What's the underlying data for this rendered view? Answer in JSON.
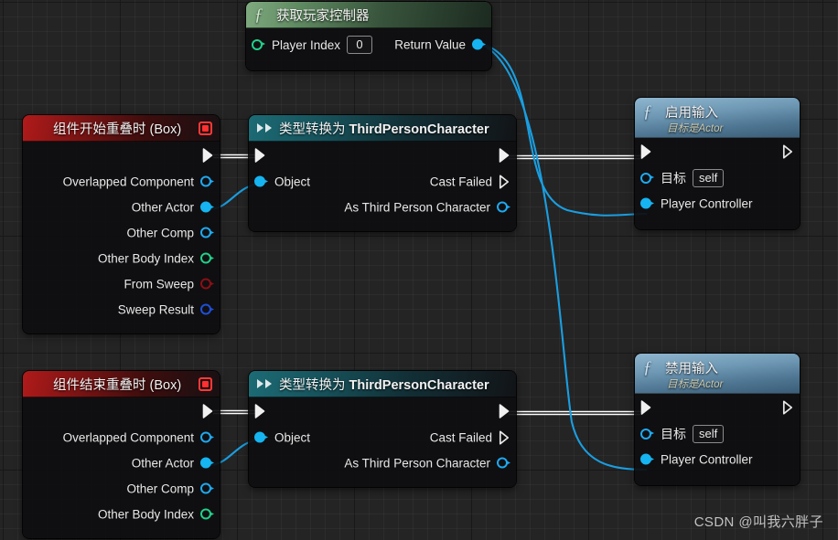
{
  "canvas": {
    "background_color": "#242424",
    "grid_minor_color": "#2f2f2f",
    "grid_major_color": "#151515"
  },
  "watermark": {
    "text": "CSDN @叫我六胖子"
  },
  "pin_colors": {
    "exec": "#ffffff",
    "object": "#1fa9f0",
    "actor": "#16b4f0",
    "int": "#22d08a",
    "bool": "#8b0f14",
    "struct": "#1f4fd8"
  },
  "nodes": [
    {
      "id": "get-player-controller",
      "title": "获取玩家控制器",
      "subtitle": "",
      "header_color": "#5f8a61",
      "icon": "function-fx-icon",
      "inputs": [
        {
          "label": "Player Index",
          "pin": "int",
          "value": "0"
        }
      ],
      "outputs": [
        {
          "label": "Return Value",
          "pin": "actor"
        }
      ]
    },
    {
      "id": "on-component-begin-overlap",
      "title": "组件开始重叠时 (Box)",
      "header_color": "#b01a1a",
      "icon": "event-diamond-icon",
      "has_stop_badge": true,
      "exec_out": true,
      "outputs": [
        {
          "label": "Overlapped Component",
          "pin": "object"
        },
        {
          "label": "Other Actor",
          "pin": "actor"
        },
        {
          "label": "Other Comp",
          "pin": "object"
        },
        {
          "label": "Other Body Index",
          "pin": "int"
        },
        {
          "label": "From Sweep",
          "pin": "bool"
        },
        {
          "label": "Sweep Result",
          "pin": "struct"
        }
      ]
    },
    {
      "id": "cast-to-thirdpersoncharacter-1",
      "title_prefix": "类型转换为 ",
      "title_class": "ThirdPersonCharacter",
      "header_color": "#17545d",
      "icon": "cast-arrows-icon",
      "exec_in": true,
      "exec_out": true,
      "inputs": [
        {
          "label": "Object",
          "pin": "object"
        }
      ],
      "outputs": [
        {
          "label": "Cast Failed",
          "pin": "exec"
        },
        {
          "label": "As Third Person Character",
          "pin": "object"
        }
      ]
    },
    {
      "id": "enable-input",
      "title": "启用输入",
      "subtitle": "目标是Actor",
      "header_color": "#6e98b4",
      "icon": "function-fx-icon",
      "exec_in": true,
      "exec_out": true,
      "inputs": [
        {
          "label": "目标",
          "pin": "object",
          "value": "self"
        },
        {
          "label": "Player Controller",
          "pin": "actor"
        }
      ]
    },
    {
      "id": "on-component-end-overlap",
      "title": "组件结束重叠时 (Box)",
      "header_color": "#b01a1a",
      "icon": "event-diamond-icon",
      "has_stop_badge": true,
      "exec_out": true,
      "outputs": [
        {
          "label": "Overlapped Component",
          "pin": "object"
        },
        {
          "label": "Other Actor",
          "pin": "actor"
        },
        {
          "label": "Other Comp",
          "pin": "object"
        },
        {
          "label": "Other Body Index",
          "pin": "int"
        }
      ]
    },
    {
      "id": "cast-to-thirdpersoncharacter-2",
      "title_prefix": "类型转换为 ",
      "title_class": "ThirdPersonCharacter",
      "header_color": "#17545d",
      "icon": "cast-arrows-icon",
      "exec_in": true,
      "exec_out": true,
      "inputs": [
        {
          "label": "Object",
          "pin": "object"
        }
      ],
      "outputs": [
        {
          "label": "Cast Failed",
          "pin": "exec"
        },
        {
          "label": "As Third Person Character",
          "pin": "object"
        }
      ]
    },
    {
      "id": "disable-input",
      "title": "禁用输入",
      "subtitle": "目标是Actor",
      "header_color": "#6e98b4",
      "icon": "function-fx-icon",
      "exec_in": true,
      "exec_out": true,
      "inputs": [
        {
          "label": "目标",
          "pin": "object",
          "value": "self"
        },
        {
          "label": "Player Controller",
          "pin": "actor"
        }
      ]
    }
  ],
  "labels": {
    "player_index": "Player Index",
    "player_index_value": "0",
    "return_value": "Return Value",
    "begin_overlap_title": "组件开始重叠时 (Box)",
    "end_overlap_title": "组件结束重叠时 (Box)",
    "overlapped_component": "Overlapped Component",
    "other_actor": "Other Actor",
    "other_comp": "Other Comp",
    "other_body_index": "Other Body Index",
    "from_sweep": "From Sweep",
    "sweep_result": "Sweep Result",
    "cast_prefix": "类型转换为 ",
    "cast_class": "ThirdPersonCharacter",
    "object": "Object",
    "cast_failed": "Cast Failed",
    "as_third_person_character": "As Third Person Character",
    "enable_input_title": "启用输入",
    "disable_input_title": "禁用输入",
    "target_is_actor": "目标是Actor",
    "target": "目标",
    "self_value": "self",
    "player_controller": "Player Controller",
    "get_player_controller_title": "获取玩家控制器"
  }
}
